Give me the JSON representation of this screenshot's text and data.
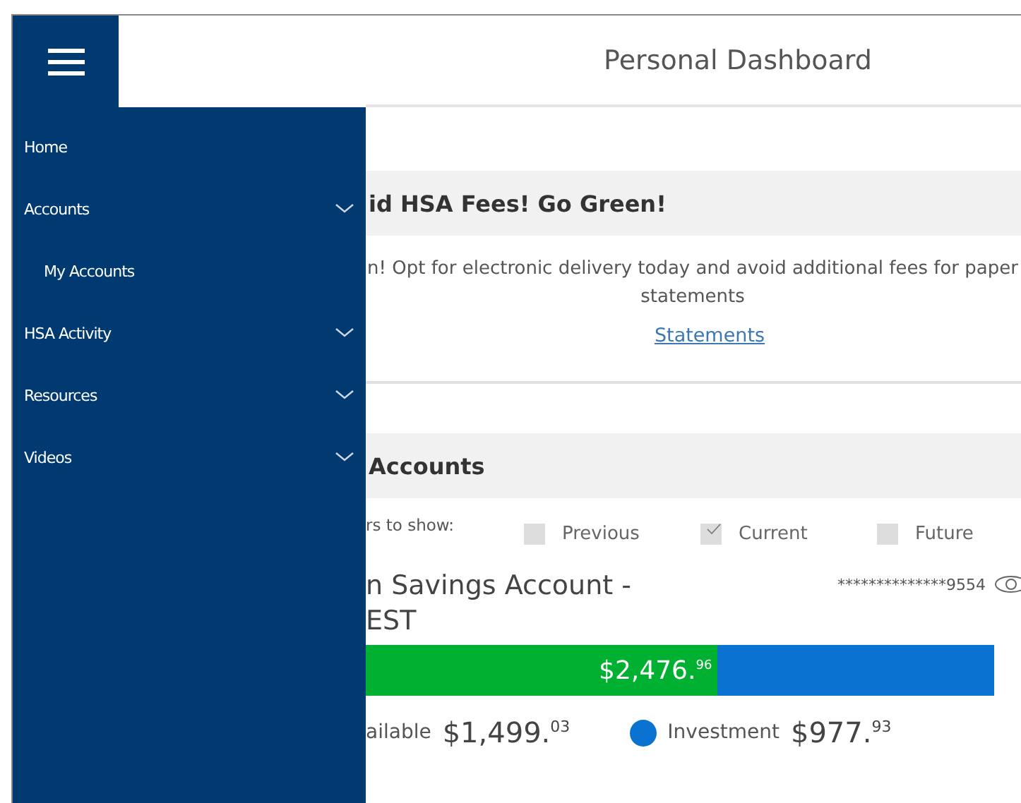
{
  "header": {
    "title": "Personal Dashboard"
  },
  "sidebar": {
    "items": [
      {
        "label": "Home",
        "expandable": false
      },
      {
        "label": "Accounts",
        "expandable": true,
        "children": [
          {
            "label": "My Accounts"
          }
        ]
      },
      {
        "label": "HSA Activity",
        "expandable": true
      },
      {
        "label": "Resources",
        "expandable": true
      },
      {
        "label": "Videos",
        "expandable": true
      }
    ]
  },
  "notice_card": {
    "title": "id HSA Fees! Go Green!",
    "message": "n! Opt for electronic delivery today and avoid additional fees for paper statements",
    "link": "Statements"
  },
  "accounts_card": {
    "title": "Accounts",
    "filter_label": "rs to show:",
    "filters": [
      {
        "label": "Previous",
        "checked": false
      },
      {
        "label": "Current",
        "checked": true
      },
      {
        "label": "Future",
        "checked": false
      }
    ],
    "account": {
      "name": "n Savings Account - EST",
      "masked_number": "**************9554",
      "balance_bar": {
        "level": 0.56,
        "label": "$2,476.$^{96}$"
      },
      "legend": [
        {
          "label": "ailable",
          "amount": "$1,499.$^{03}$"
        },
        {
          "label": "Investment",
          "amount": "$977.$^{93}$",
          "color": "#0a72d0"
        }
      ]
    }
  }
}
